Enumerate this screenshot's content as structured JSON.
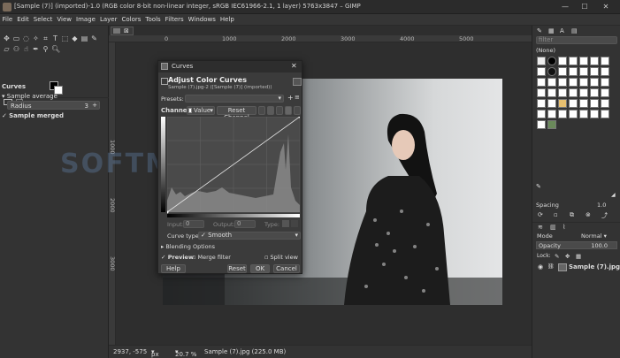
{
  "window": {
    "title": "[Sample (7)] (imported)-1.0 (RGB color 8-bit non-linear integer, sRGB IEC61966-2.1, 1 layer) 5763x3847 – GIMP",
    "minimize": "—",
    "maximize": "☐",
    "close": "✕"
  },
  "menu": [
    "File",
    "Edit",
    "Select",
    "View",
    "Image",
    "Layer",
    "Colors",
    "Tools",
    "Filters",
    "Windows",
    "Help"
  ],
  "tool_options": {
    "section": "Curves",
    "sample_average": "Sample average",
    "radius_label": "Radius",
    "radius_value": "3",
    "sample_merged": "Sample merged"
  },
  "ruler": {
    "h_ticks": [
      "0",
      "1000",
      "2000",
      "3000",
      "4000",
      "5000"
    ],
    "v_ticks": [
      "1000",
      "2000",
      "3000"
    ]
  },
  "watermark": "SOFTMOBA",
  "status": {
    "coords": "2937, -575",
    "unit": "px",
    "zoom": "20.7 %",
    "file": "Sample (7).jpg (225.0 MB)"
  },
  "curves_dialog": {
    "title": "Curves",
    "heading": "Adjust Color Curves",
    "subheading": "Sample (7).jpg-2 ([Sample (7)] (imported))",
    "presets_label": "Presets:",
    "channel_label": "Channel:",
    "channel_value": "Value",
    "reset_channel": "Reset Channel",
    "input_label": "Input:",
    "input_value": "0",
    "output_label": "Output:",
    "output_value": "0",
    "type_label": "Type:",
    "curve_type_label": "Curve type:",
    "curve_type_value": "✓ Smooth",
    "blending": "Blending Options",
    "preview": "Preview",
    "merge_filter": "Merge filter",
    "split_view": "Split view",
    "help": "Help",
    "reset": "Reset",
    "ok": "OK",
    "cancel": "Cancel"
  },
  "right_dock": {
    "filter_placeholder": "filter",
    "brush_name": "(None)",
    "spacing_label": "Spacing",
    "spacing_value": "1.0",
    "mode_label": "Mode",
    "mode_value": "Normal",
    "opacity_label": "Opacity",
    "opacity_value": "100.0",
    "lock_label": "Lock:",
    "layer_name": "Sample (7).jpg"
  },
  "colors": {
    "accent": "#5b8fd6",
    "background": "#454545",
    "panel": "#333333"
  }
}
